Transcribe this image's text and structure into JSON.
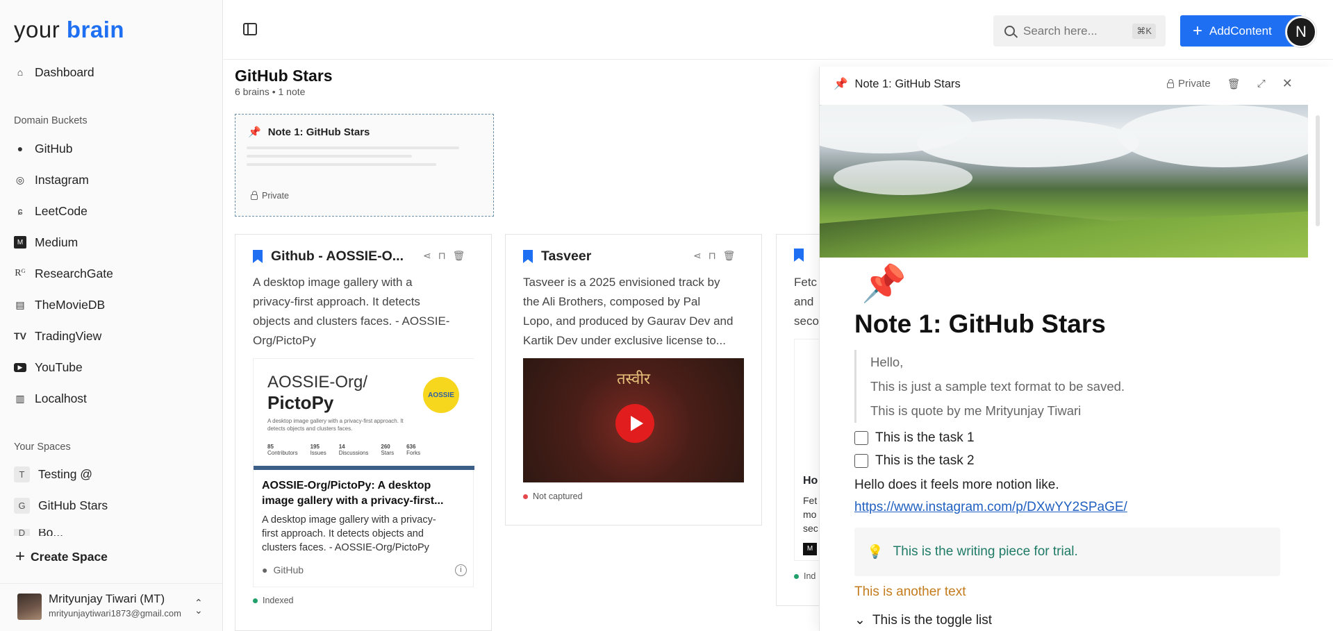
{
  "sidebar": {
    "logo_prefix": "your",
    "logo_brand": "brain",
    "dashboard": "Dashboard",
    "domain_label": "Domain Buckets",
    "domains": [
      "GitHub",
      "Instagram",
      "LeetCode",
      "Medium",
      "ResearchGate",
      "TheMovieDB",
      "TradingView",
      "YouTube",
      "Localhost"
    ],
    "spaces_label": "Your Spaces",
    "spaces": [
      {
        "letter": "T",
        "name": "Testing @"
      },
      {
        "letter": "G",
        "name": "GitHub Stars"
      },
      {
        "letter": "D",
        "name": "Bo..."
      }
    ],
    "create_space": "Create Space",
    "user_name": "Mrityunjay Tiwari (MT)",
    "user_email": "mrityunjaytiwari1873@gmail.com"
  },
  "header": {
    "search_placeholder": "Search here...",
    "shortcut": "⌘K",
    "add_content": "AddContent",
    "profile_initial": "N"
  },
  "main": {
    "title": "GitHub Stars",
    "subtitle": "6 brains • 1 note",
    "note_card": {
      "title": "Note 1: GitHub Stars",
      "visibility": "Private"
    },
    "cards": [
      {
        "title": "Github - AOSSIE-O...",
        "desc": [
          "A desktop image gallery with a",
          "privacy-first approach. It detects",
          "objects and clusters faces. - AOSSIE-",
          "Org/PictoPy"
        ],
        "preview": {
          "repo_line1": "AOSSIE-Org/",
          "repo_line2": "PictoPy",
          "repo_desc": "A desktop image gallery with a privacy-first approach. It detects objects and clusters faces.",
          "stats": [
            {
              "n": "85",
              "l": "Contributors"
            },
            {
              "n": "195",
              "l": "Issues"
            },
            {
              "n": "14",
              "l": "Discussions"
            },
            {
              "n": "260",
              "l": "Stars"
            },
            {
              "n": "636",
              "l": "Forks"
            }
          ],
          "badge": "AOSSIE",
          "link_title": "AOSSIE-Org/PictoPy: A desktop image gallery with a privacy-first...",
          "link_desc": [
            "A desktop image gallery with a privacy-",
            "first approach. It detects objects and",
            "clusters faces. - AOSSIE-Org/PictoPy"
          ],
          "source": "GitHub"
        },
        "status": "Indexed",
        "status_color": "#22a06b"
      },
      {
        "title": "Tasveer",
        "desc": [
          "Tasveer is a 2025 envisioned track by",
          "the Ali Brothers, composed by Pal",
          "Lopo, and produced by Gaurav Dev and",
          "Kartik Dev under exclusive license to..."
        ],
        "video_title": "तस्वीर",
        "status": "Not captured",
        "status_color": "#e5484d"
      },
      {
        "desc": [
          "Fetc",
          "and",
          "seco"
        ],
        "sub_title": "Ho",
        "sub_desc": [
          "Fet",
          "mo",
          "sec"
        ],
        "status": "Ind",
        "status_color": "#22a06b"
      }
    ]
  },
  "panel": {
    "title": "Note 1: GitHub Stars",
    "visibility": "Private",
    "heading": "Note 1: GitHub Stars",
    "quote": [
      "Hello,",
      "This is just a sample text format to be saved.",
      "This is quote by me Mrityunjay Tiwari"
    ],
    "tasks": [
      "This is the task 1",
      "This is the task 2"
    ],
    "para": "Hello does it feels more notion like.",
    "link": "https://www.instagram.com/p/DXwYY2SPaGE/",
    "callout": "This is the writing piece for trial.",
    "orange": "This is another text",
    "toggle": "This is the toggle list"
  }
}
